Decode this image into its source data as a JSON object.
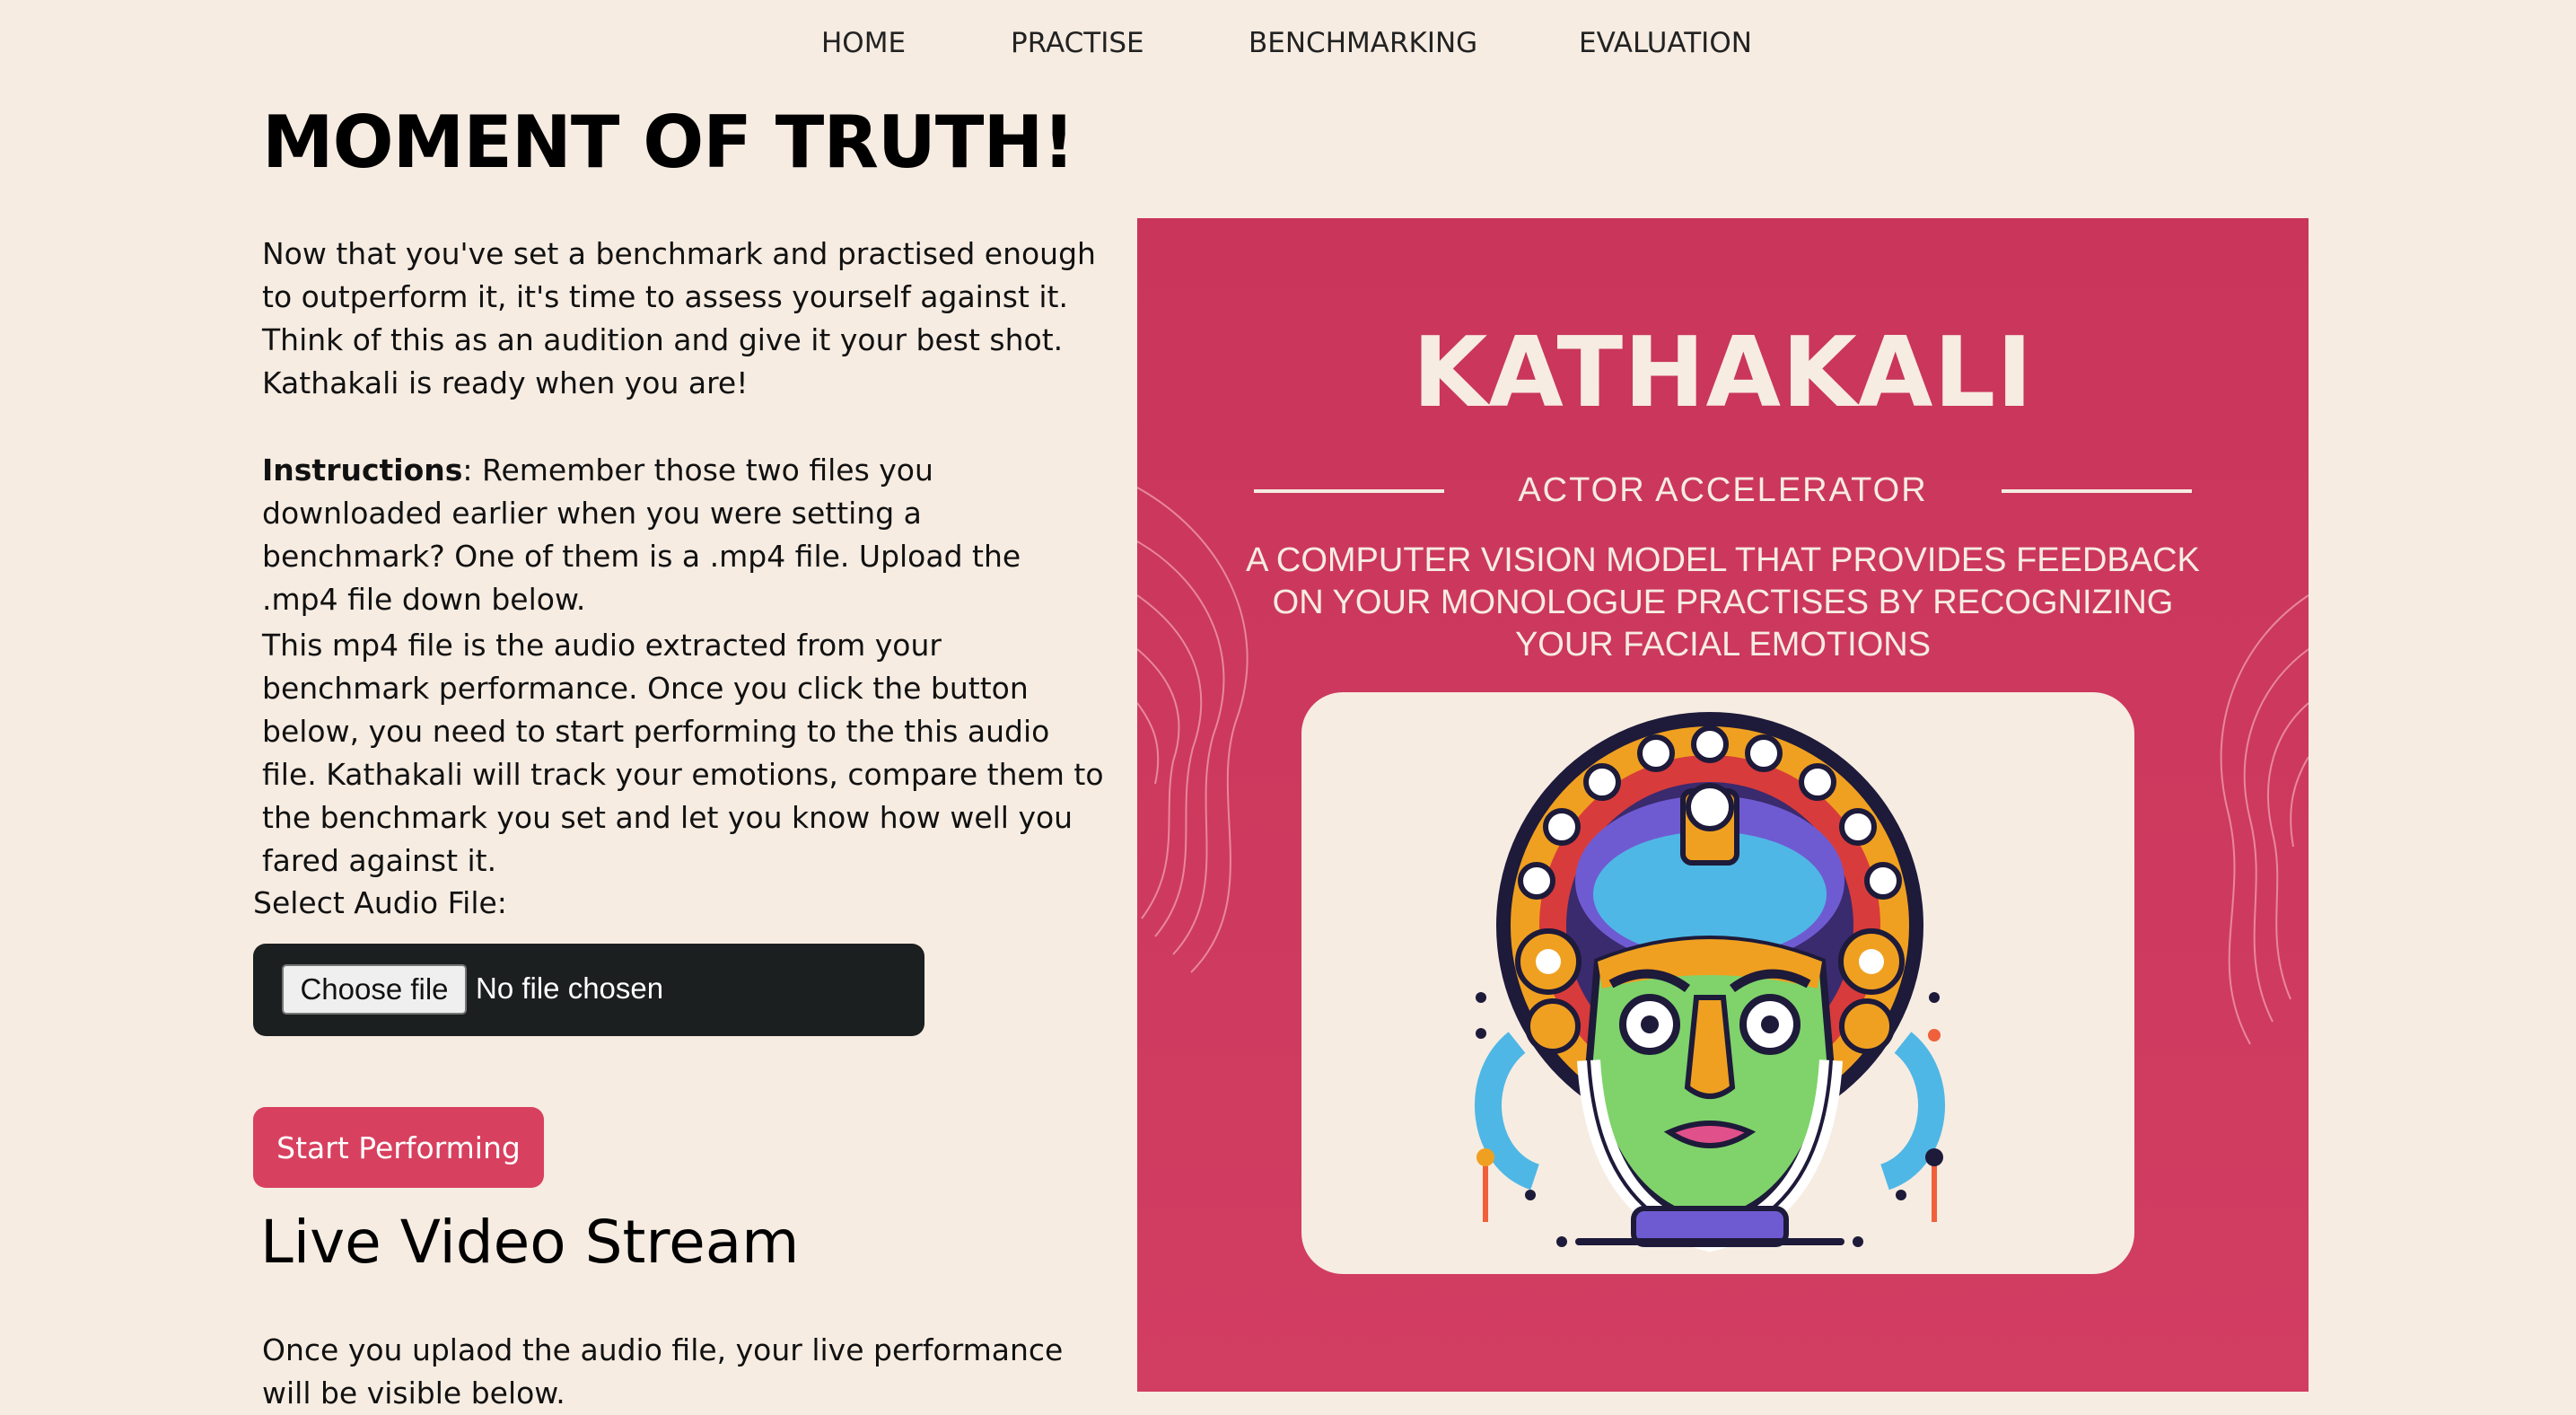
{
  "nav": {
    "items": [
      "HOME",
      "PRACTISE",
      "BENCHMARKING",
      "EVALUATION"
    ]
  },
  "page": {
    "title": "MOMENT OF TRUTH!",
    "intro": "Now that you've set a benchmark and practised enough to outperform it, it's time to assess yourself against it. Think of this as an audition and give it your best shot. Kathakali is ready when you are!",
    "instructions_label": "Instructions",
    "instructions_text": ": Remember those two files you downloaded earlier when you were setting a benchmark? One of them is a .mp4 file. Upload the .mp4 file down below.",
    "explanation": "This mp4 file is the audio extracted from your benchmark performance. Once you click the button below, you need to start performing to the this audio file. Kathakali will track your emotions, compare them to the benchmark you set and let you know how well you fared against it.",
    "select_label": "Select Audio File:",
    "choose_file_label": "Choose file",
    "file_status": "No file chosen",
    "start_button": "Start Performing",
    "stream_heading": "Live Video Stream",
    "stream_text": "Once you uplaod the audio file, your live performance will be visible below."
  },
  "poster": {
    "title": "KATHAKALI",
    "subtitle": "ACTOR  ACCELERATOR",
    "description": "A COMPUTER VISION MODEL THAT PROVIDES FEEDBACK ON YOUR MONOLOGUE PRACTISES BY RECOGNIZING YOUR FACIAL EMOTIONS"
  },
  "colors": {
    "background": "#f6ece2",
    "accent": "#d8405f",
    "poster": "#c9355b",
    "file_box": "#1c1f20"
  }
}
